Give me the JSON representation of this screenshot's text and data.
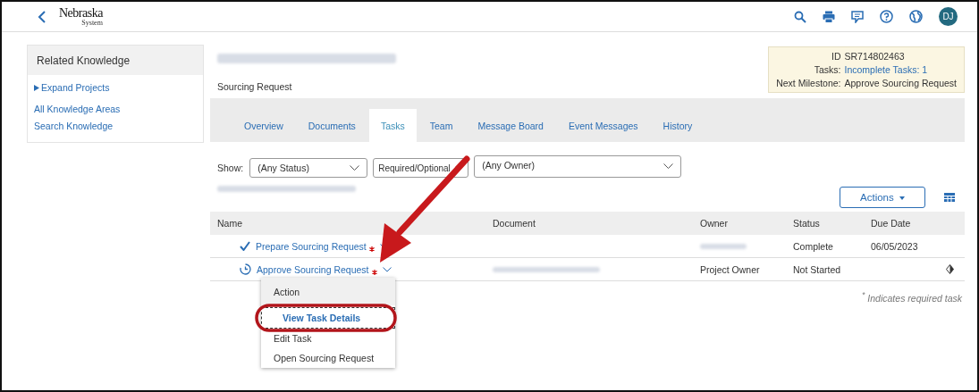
{
  "header": {
    "logo": "Nebraska",
    "logo_sub": "System",
    "avatar": "DJ"
  },
  "sidebar": {
    "title": "Related Knowledge",
    "items": [
      {
        "label": "Expand Projects",
        "kind": "expander"
      },
      {
        "label": "All Knowledge Areas",
        "kind": "link"
      },
      {
        "label": "Search Knowledge",
        "kind": "link"
      }
    ]
  },
  "document": {
    "subtitle": "Sourcing Request"
  },
  "summary": {
    "id_label": "ID",
    "id": "SR714802463",
    "tasks_label": "Tasks:",
    "tasks": "Incomplete Tasks: 1",
    "milestone_label": "Next Milestone:",
    "milestone": "Approve Sourcing Request"
  },
  "tabs": [
    {
      "label": "Overview",
      "selected": false
    },
    {
      "label": "Documents",
      "selected": false
    },
    {
      "label": "Tasks",
      "selected": true
    },
    {
      "label": "Team",
      "selected": false
    },
    {
      "label": "Message Board",
      "selected": false
    },
    {
      "label": "Event Messages",
      "selected": false
    },
    {
      "label": "History",
      "selected": false
    }
  ],
  "filters": {
    "label": "Show:",
    "dropdowns": [
      {
        "value": "(Any Status)"
      },
      {
        "value": "Required/Optional"
      },
      {
        "value": "(Any Owner)"
      }
    ]
  },
  "actions_button": "Actions",
  "table": {
    "columns": [
      "Name",
      "Document",
      "Owner",
      "Status",
      "Due Date"
    ],
    "rows": [
      {
        "kind": "complete",
        "name": "Prepare Sourcing Request",
        "required": true,
        "owner": null,
        "status": "Complete",
        "due": "06/05/2023"
      },
      {
        "kind": "pending",
        "name": "Approve Sourcing Request",
        "required": true,
        "owner": "Project Owner",
        "status": "Not Started",
        "due": null
      }
    ]
  },
  "footnote": "$^{*}$ Indicates required task",
  "menu": {
    "title": "Action",
    "items": [
      {
        "label": "View Task Details",
        "selected": true
      },
      {
        "label": "Edit Task",
        "selected": false
      },
      {
        "label": "Open Sourcing Request",
        "selected": false
      }
    ]
  }
}
